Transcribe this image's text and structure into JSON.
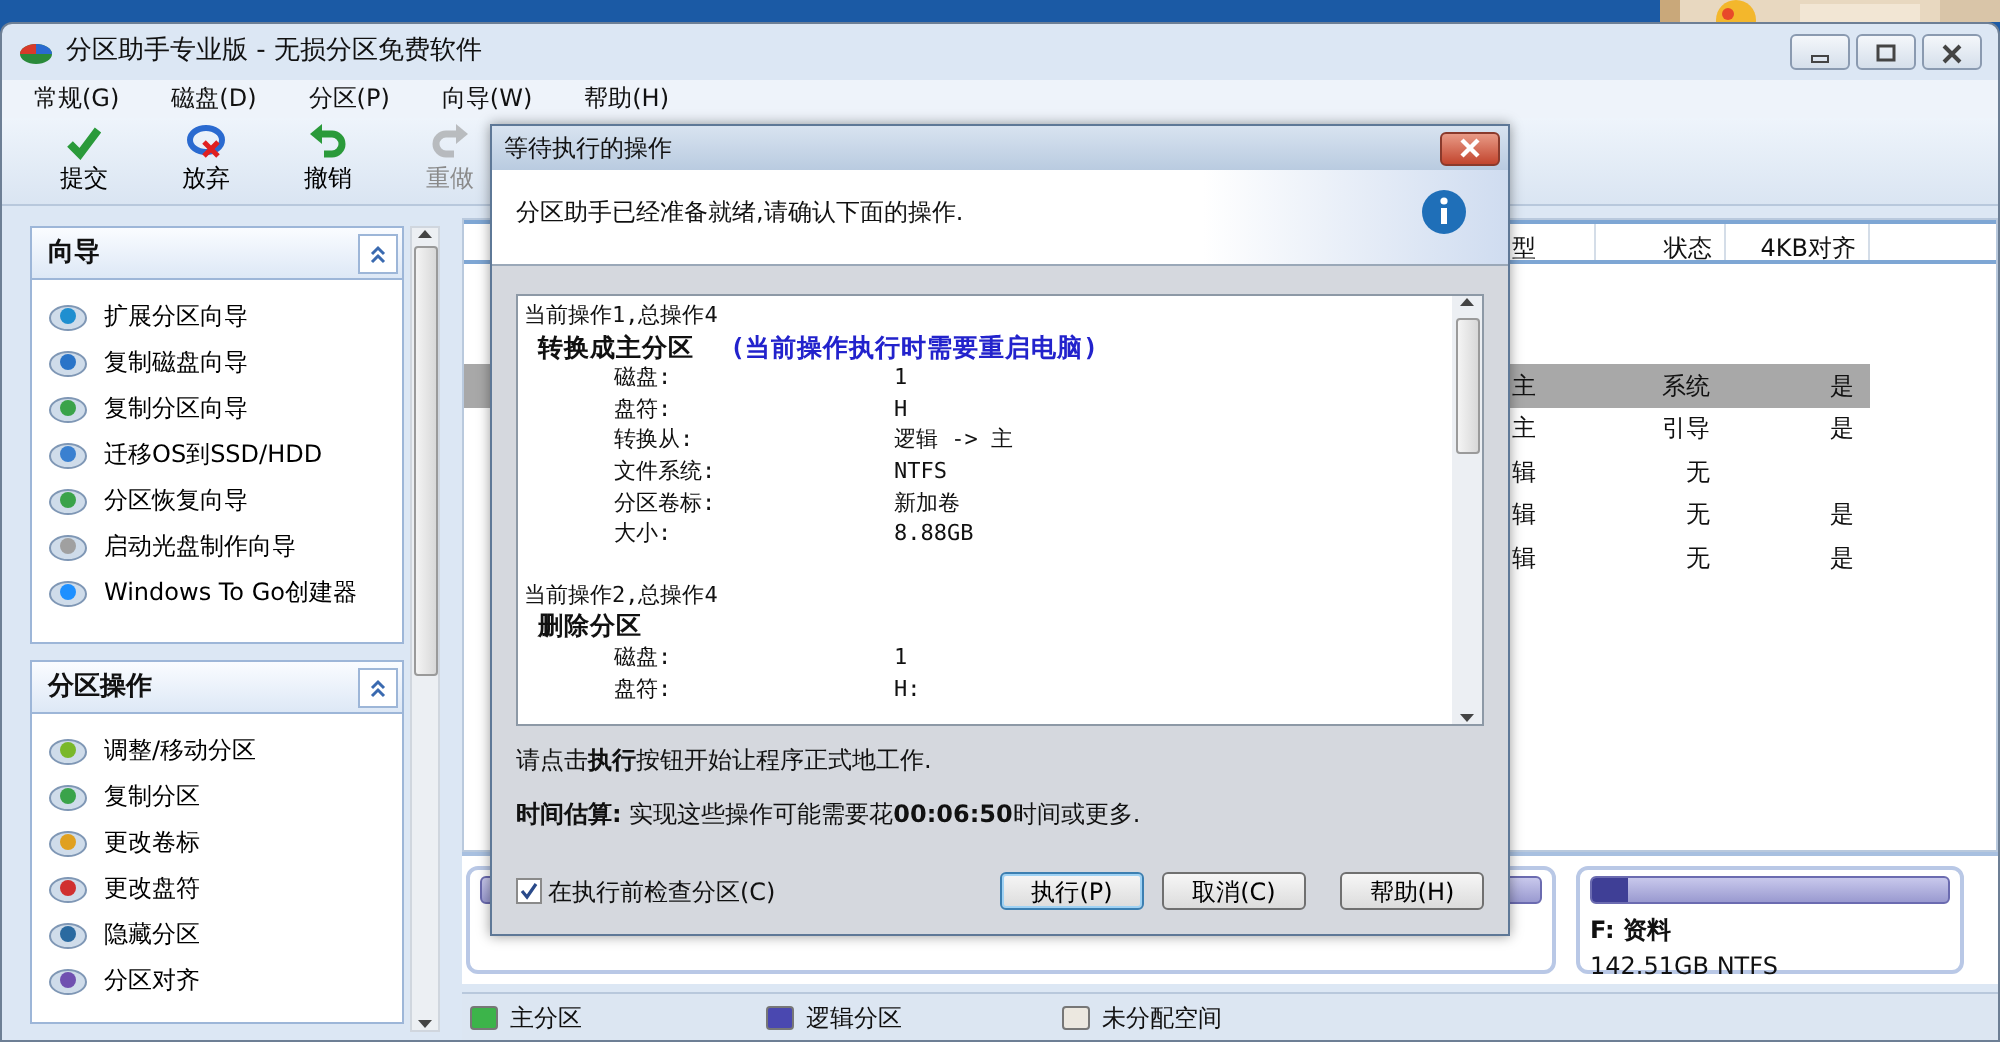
{
  "window": {
    "title": "分区助手专业版 - 无损分区免费软件"
  },
  "menu": [
    "常规(G)",
    "磁盘(D)",
    "分区(P)",
    "向导(W)",
    "帮助(H)"
  ],
  "toolbar": [
    {
      "kind": "commit",
      "label": "提交",
      "disabled": false
    },
    {
      "kind": "discard",
      "label": "放弃",
      "disabled": false
    },
    {
      "kind": "undo",
      "label": "撤销",
      "disabled": false
    },
    {
      "kind": "redo",
      "label": "重做",
      "disabled": true
    }
  ],
  "sidebar": {
    "sections": [
      {
        "title": "向导",
        "expanded": true,
        "items": [
          "扩展分区向导",
          "复制磁盘向导",
          "复制分区向导",
          "迁移OS到SSD/HDD",
          "分区恢复向导",
          "启动光盘制作向导",
          "Windows To Go创建器"
        ]
      },
      {
        "title": "分区操作",
        "expanded": true,
        "items": [
          "调整/移动分区",
          "复制分区",
          "更改卷标",
          "更改盘符",
          "隐藏分区",
          "分区对齐"
        ]
      }
    ]
  },
  "table": {
    "columns": [
      "型",
      "状态",
      "4KB对齐"
    ],
    "rows": [
      {
        "selected": true,
        "cells": [
          "主",
          "系统",
          "是"
        ]
      },
      {
        "selected": false,
        "cells": [
          "主",
          "引导",
          "是"
        ]
      },
      {
        "selected": false,
        "cells": [
          "辑",
          "无",
          null
        ]
      },
      {
        "selected": false,
        "cells": [
          "辑",
          "无",
          "是"
        ]
      },
      {
        "selected": false,
        "cells": [
          "辑",
          "无",
          "是"
        ]
      }
    ]
  },
  "disk_map": {
    "partitions": [
      {
        "name": "F: 资料",
        "details": "142.51GB NTFS",
        "level": 0.1
      }
    ]
  },
  "legend": [
    {
      "label": "主分区",
      "color": "#3cb44a"
    },
    {
      "label": "逻辑分区",
      "color": "#4a48b0"
    },
    {
      "label": "未分配空间",
      "color": "#ece8e0"
    }
  ],
  "dialog": {
    "title": "等待执行的操作",
    "message": "分区助手已经准备就绪,请确认下面的操作.",
    "operations": [
      {
        "header": "当前操作1,总操作4",
        "title": "转换成主分区",
        "note": "(当前操作执行时需要重启电脑)",
        "fields": [
          {
            "label": "磁盘:",
            "value": "1"
          },
          {
            "label": "盘符:",
            "value": "H"
          },
          {
            "label": "转换从:",
            "value": "逻辑 -> 主"
          },
          {
            "label": "文件系统:",
            "value": "NTFS"
          },
          {
            "label": "分区卷标:",
            "value": "新加卷"
          },
          {
            "label": "大小:",
            "value": "8.88GB"
          }
        ]
      },
      {
        "header": "当前操作2,总操作4",
        "title": "删除分区",
        "fields": [
          {
            "label": "磁盘:",
            "value": "1"
          },
          {
            "label": "盘符:",
            "value": "H:"
          }
        ]
      }
    ],
    "instruction": "请点击**执行**按钮开始让程序正式地工作.",
    "estimate": "**时间估算:** 实现这些操作可能需要花**00:06:50**时间或更多.",
    "check_before": {
      "label": "在执行前检查分区(C)",
      "checked": true
    },
    "buttons": [
      {
        "label": "执行(P)",
        "default": true
      },
      {
        "label": "取消(C)",
        "default": false
      },
      {
        "label": "帮助(H)",
        "default": false
      }
    ]
  }
}
